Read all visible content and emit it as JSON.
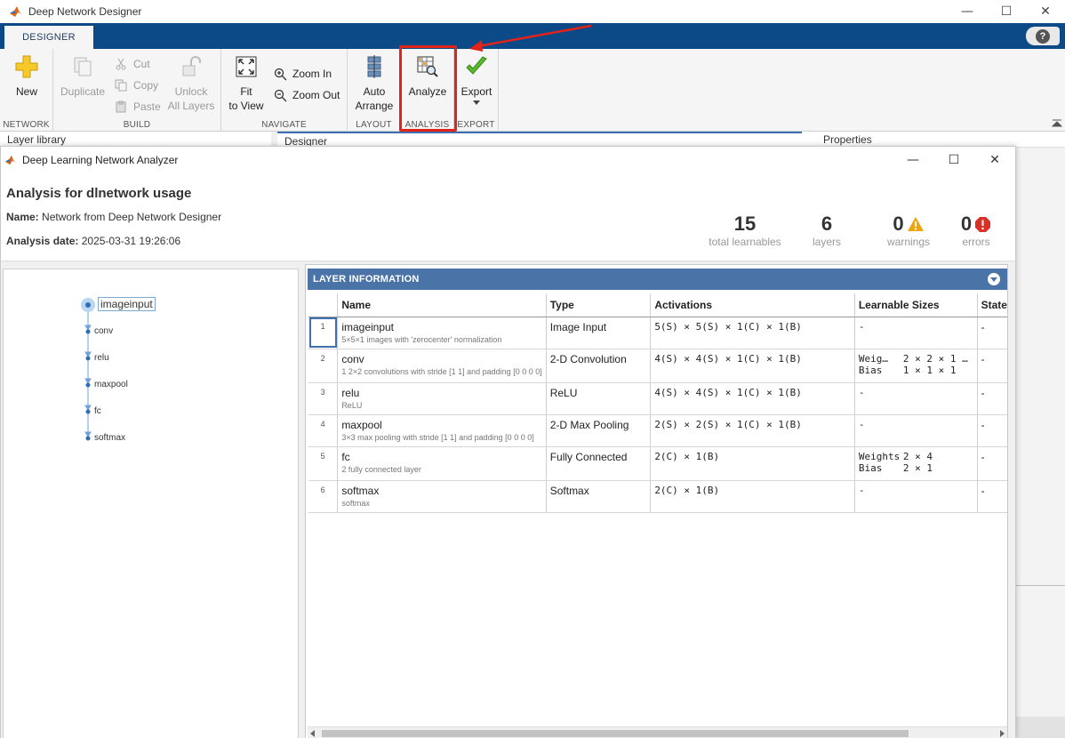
{
  "app": {
    "title": "Deep Network Designer",
    "tab": "DESIGNER",
    "help": "?"
  },
  "toolstrip": {
    "groups": {
      "network": "NETWORK",
      "build": "BUILD",
      "navigate": "NAVIGATE",
      "layout": "LAYOUT",
      "analysis": "ANALYSIS",
      "export": "EXPORT"
    },
    "new_label": "New",
    "duplicate_label": "Duplicate",
    "cut_label": "Cut",
    "copy_label": "Copy",
    "paste_label": "Paste",
    "unlock_label_1": "Unlock",
    "unlock_label_2": "All Layers",
    "fit_label_1": "Fit",
    "fit_label_2": "to View",
    "zoom_in_label": "Zoom In",
    "zoom_out_label": "Zoom Out",
    "auto_label_1": "Auto",
    "auto_label_2": "Arrange",
    "analyze_label": "Analyze",
    "export_label": "Export"
  },
  "panes": {
    "layer_library": "Layer library",
    "designer": "Designer",
    "properties": "Properties"
  },
  "analyzer": {
    "window_title": "Deep Learning Network Analyzer",
    "heading": "Analysis for dlnetwork usage",
    "name_label": "Name:",
    "name_value": "Network from Deep Network Designer",
    "date_label": "Analysis date:",
    "date_value": "2025-03-31 19:26:06",
    "stats": {
      "learnables": "15",
      "learnables_cap": "total learnables",
      "layers": "6",
      "layers_cap": "layers",
      "warnings": "0",
      "warnings_cap": "warnings",
      "errors": "0",
      "errors_cap": "errors"
    },
    "graph_nodes": [
      "imageinput",
      "conv",
      "relu",
      "maxpool",
      "fc",
      "softmax"
    ],
    "table_title": "LAYER INFORMATION",
    "columns": [
      "",
      "Name",
      "Type",
      "Activations",
      "Learnable Sizes",
      "State"
    ],
    "rows": [
      {
        "idx": "1",
        "name": "imageinput",
        "desc": "5×5×1 images with 'zerocenter' normalization",
        "type": "Image Input",
        "act": "5(S) × 5(S) × 1(C) × 1(B)",
        "learn": [
          [
            "-",
            ""
          ]
        ],
        "state": "-"
      },
      {
        "idx": "2",
        "name": "conv",
        "desc": "1 2×2 convolutions with stride [1 1] and padding [0 0 0 0]",
        "type": "2-D Convolution",
        "act": "4(S) × 4(S) × 1(C) × 1(B)",
        "learn": [
          [
            "Weig…",
            "2 × 2 × 1 …"
          ],
          [
            "Bias",
            "1 × 1 × 1"
          ]
        ],
        "state": "-"
      },
      {
        "idx": "3",
        "name": "relu",
        "desc": "ReLU",
        "type": "ReLU",
        "act": "4(S) × 4(S) × 1(C) × 1(B)",
        "learn": [
          [
            "-",
            ""
          ]
        ],
        "state": "-"
      },
      {
        "idx": "4",
        "name": "maxpool",
        "desc": "3×3 max pooling with stride [1 1] and padding [0 0 0 0]",
        "type": "2-D Max Pooling",
        "act": "2(S) × 2(S) × 1(C) × 1(B)",
        "learn": [
          [
            "-",
            ""
          ]
        ],
        "state": "-"
      },
      {
        "idx": "5",
        "name": "fc",
        "desc": "2 fully connected layer",
        "type": "Fully Connected",
        "act": "2(C) × 1(B)",
        "learn": [
          [
            "Weights",
            "2 × 4"
          ],
          [
            "Bias",
            "2 × 1"
          ]
        ],
        "state": "-"
      },
      {
        "idx": "6",
        "name": "softmax",
        "desc": "softmax",
        "type": "Softmax",
        "act": "2(C) × 1(B)",
        "learn": [
          [
            "-",
            ""
          ]
        ],
        "state": "-"
      }
    ]
  },
  "colors": {
    "accent": "#0b4a86",
    "table_header": "#4a73a8",
    "highlight": "#e2231a",
    "warning": "#f0a30a",
    "error": "#d9312a"
  }
}
